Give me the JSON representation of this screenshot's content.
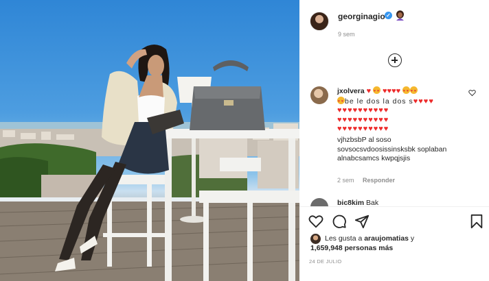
{
  "post": {
    "username": "georginagio",
    "time_ago": "9 sem",
    "date": "24 DE JULIO"
  },
  "comments": [
    {
      "username": "jxolvera",
      "line1_tail": "be le dos la dos s",
      "text": "vjhzbsbP al soso sovsocsvdoosissinsksbk soplaban alnabcsamcs kwpqjsjis",
      "time_ago": "2 sem",
      "reply_label": "Responder"
    },
    {
      "username": "bic8kim",
      "text": "Bak"
    }
  ],
  "likes": {
    "prefix": "Les gusta a",
    "first_user": "araujomatias",
    "connector": "y",
    "count": "1,659,948 personas más"
  },
  "icons": {
    "verified": "verified-badge-icon",
    "emoji": "woman-emoji-icon",
    "add": "add-circle-icon",
    "like": "heart-icon",
    "comment": "comment-icon",
    "share": "share-icon",
    "save": "bookmark-icon"
  },
  "colors": {
    "verified": "#3897f0",
    "heart_emoji": "#ed2b2b",
    "muted_text": "#8e8e8e"
  }
}
